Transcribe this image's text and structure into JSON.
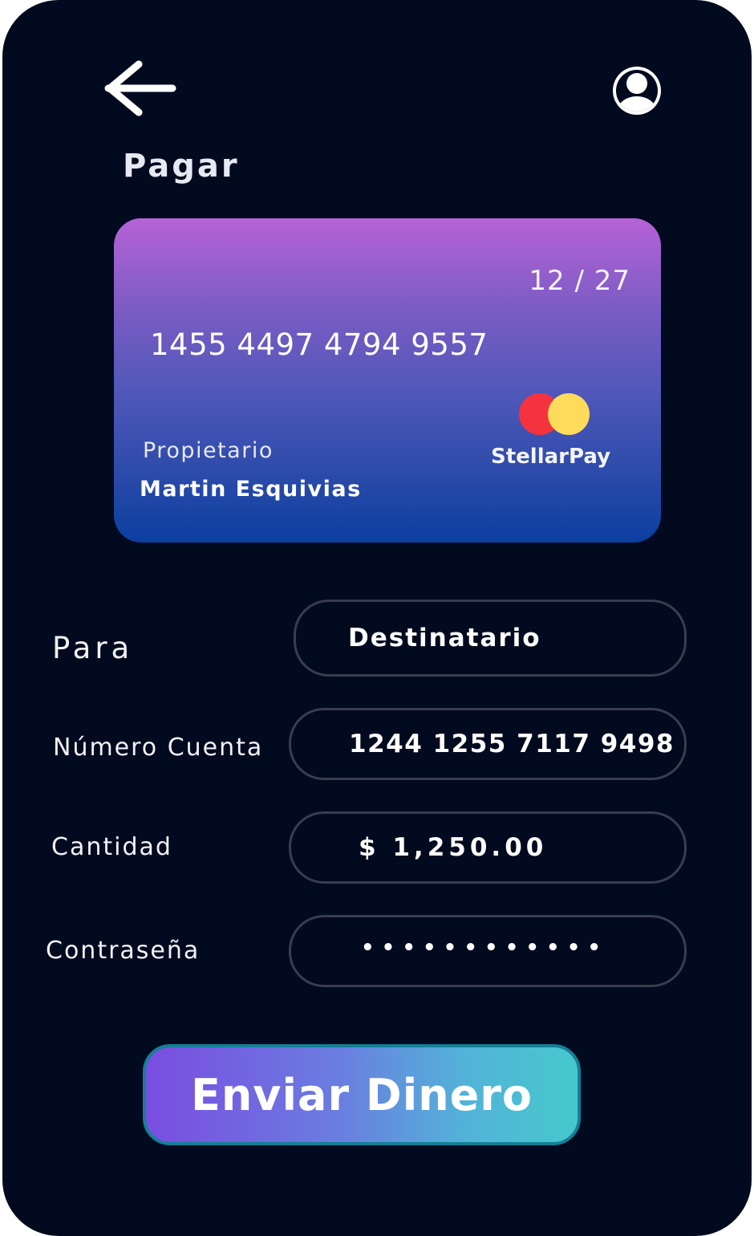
{
  "header": {
    "back_icon": "arrow-left-icon",
    "profile_icon": "user-circle-icon",
    "title": "Pagar"
  },
  "card": {
    "expiry": "12 / 27",
    "number": "1455 4497 4794 9557",
    "owner_label": "Propietario",
    "owner_name": "Martin Esquivias",
    "brand_name": "StellarPay",
    "brand_icon": "overlapping-circles-logo",
    "gradient_top": "#b662d6",
    "gradient_bottom": "#0a3fa0"
  },
  "form": {
    "para": {
      "label": "Para",
      "value": "Destinatario"
    },
    "account": {
      "label": "Número Cuenta",
      "value": "1244 1255 7117 9498"
    },
    "amount": {
      "label": "Cantidad",
      "value": "$ 1,250.00"
    },
    "password": {
      "label": "Contraseña",
      "value": "• • • • • • • • • • • •"
    }
  },
  "actions": {
    "send_label": "Enviar Dinero"
  },
  "colors": {
    "background": "#020a1f",
    "field_border": "#3a3d4f",
    "button_start": "#7a4de0",
    "button_end": "#46c8cc",
    "button_border": "#138096",
    "logo_red": "#f4333f",
    "logo_yellow": "#fedb5b"
  }
}
